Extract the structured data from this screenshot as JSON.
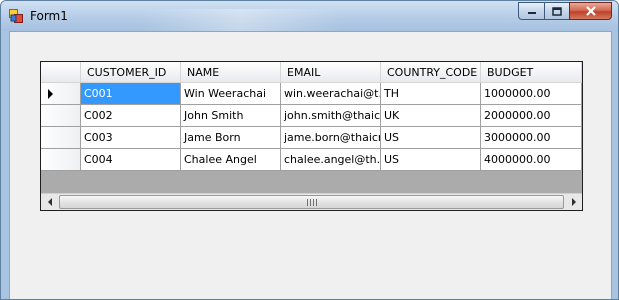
{
  "window": {
    "title": "Form1",
    "icon": "winforms-app-icon",
    "buttons": [
      "minimize-icon",
      "maximize-icon",
      "close-icon"
    ]
  },
  "grid": {
    "columns": [
      "CUSTOMER_ID",
      "NAME",
      "EMAIL",
      "COUNTRY_CODE",
      "BUDGET"
    ],
    "rows": [
      [
        "C001",
        "Win  Weerachai",
        "win.weerachai@t...",
        "TH",
        "1000000.00"
      ],
      [
        "C002",
        "John  Smith",
        "john.smith@thaic...",
        "UK",
        "2000000.00"
      ],
      [
        "C003",
        "Jame Born",
        "jame.born@thaicr...",
        "US",
        "3000000.00"
      ],
      [
        "C004",
        "Chalee Angel",
        "chalee.angel@th...",
        "US",
        "4000000.00"
      ]
    ],
    "current_row_index": 0,
    "selected_cell": "C001",
    "scrollbar_grip": "III"
  },
  "colors": {
    "selection": "#3399ff",
    "grid_background": "#ababab",
    "close_button": "#c0412a"
  }
}
